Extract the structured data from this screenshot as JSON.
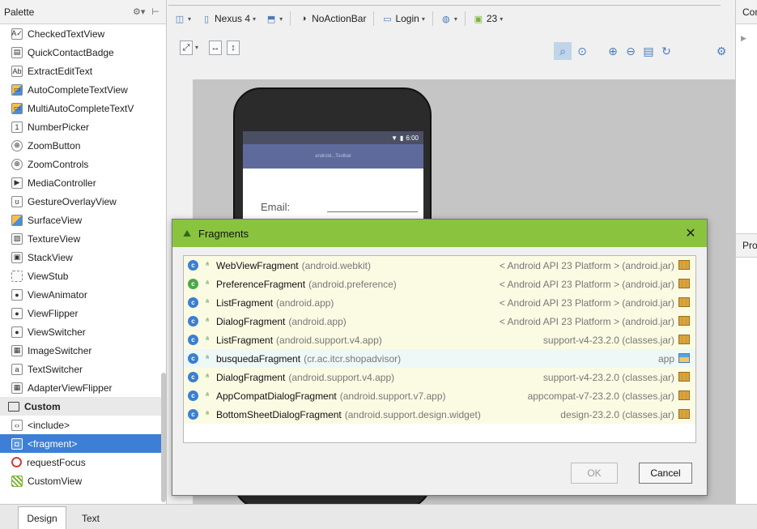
{
  "palette": {
    "title": "Palette",
    "items": [
      {
        "label": "CheckedTextView",
        "icon": "checked-text-icon",
        "glyph": "A✓"
      },
      {
        "label": "QuickContactBadge",
        "icon": "contact-badge-icon",
        "glyph": "▤"
      },
      {
        "label": "ExtractEditText",
        "icon": "edit-text-icon",
        "glyph": "Ab"
      },
      {
        "label": "AutoCompleteTextView",
        "icon": "autocomplete-icon",
        "glyph": "▭"
      },
      {
        "label": "MultiAutoCompleteTextV",
        "icon": "multi-autocomplete-icon",
        "glyph": "▭"
      },
      {
        "label": "NumberPicker",
        "icon": "number-picker-icon",
        "glyph": "1"
      },
      {
        "label": "ZoomButton",
        "icon": "zoom-button-icon",
        "glyph": "⊕"
      },
      {
        "label": "ZoomControls",
        "icon": "zoom-controls-icon",
        "glyph": "⊕"
      },
      {
        "label": "MediaController",
        "icon": "media-controller-icon",
        "glyph": "▶"
      },
      {
        "label": "GestureOverlayView",
        "icon": "gesture-overlay-icon",
        "glyph": "ʊ"
      },
      {
        "label": "SurfaceView",
        "icon": "surface-view-icon",
        "glyph": ""
      },
      {
        "label": "TextureView",
        "icon": "texture-view-icon",
        "glyph": "▨"
      },
      {
        "label": "StackView",
        "icon": "stack-view-icon",
        "glyph": "▣"
      },
      {
        "label": "ViewStub",
        "icon": "view-stub-icon",
        "glyph": ""
      },
      {
        "label": "ViewAnimator",
        "icon": "view-animator-icon",
        "glyph": "●"
      },
      {
        "label": "ViewFlipper",
        "icon": "view-flipper-icon",
        "glyph": "●"
      },
      {
        "label": "ViewSwitcher",
        "icon": "view-switcher-icon",
        "glyph": "●"
      },
      {
        "label": "ImageSwitcher",
        "icon": "image-switcher-icon",
        "glyph": "▦"
      },
      {
        "label": "TextSwitcher",
        "icon": "text-switcher-icon",
        "glyph": "a"
      },
      {
        "label": "AdapterViewFlipper",
        "icon": "adapter-flipper-icon",
        "glyph": "▦"
      }
    ],
    "category_custom": "Custom",
    "custom_items": [
      {
        "label": "<include>",
        "icon": "include-icon",
        "glyph": "‹›"
      },
      {
        "label": "<fragment>",
        "icon": "fragment-icon",
        "glyph": "◘"
      },
      {
        "label": "requestFocus",
        "icon": "request-focus-icon",
        "glyph": ""
      },
      {
        "label": "CustomView",
        "icon": "custom-view-icon",
        "glyph": ""
      }
    ]
  },
  "toolbar": {
    "device": "Nexus 4",
    "theme": "NoActionBar",
    "activity": "Login",
    "api": "23"
  },
  "phone": {
    "status_time": "6:00",
    "app_bar_text": "android...Toolbar",
    "email_label": "Email:"
  },
  "right_panel": {
    "component_tree_header": "Component Tree",
    "properties_header": "Properties"
  },
  "bottom_tabs": {
    "design": "Design",
    "text": "Text"
  },
  "dialog": {
    "title": "Fragments",
    "close_glyph": "✕",
    "ok_label": "OK",
    "cancel_label": "Cancel",
    "results": [
      {
        "name": "WebViewFragment",
        "pkg": "(android.webkit)",
        "source": "< Android API 23 Platform > (android.jar)",
        "kind": "platform",
        "icon_style": "blue"
      },
      {
        "name": "PreferenceFragment",
        "pkg": "(android.preference)",
        "source": "< Android API 23 Platform > (android.jar)",
        "kind": "platform",
        "icon_style": "green"
      },
      {
        "name": "ListFragment",
        "pkg": "(android.app)",
        "source": "< Android API 23 Platform > (android.jar)",
        "kind": "platform",
        "icon_style": "blue"
      },
      {
        "name": "DialogFragment",
        "pkg": "(android.app)",
        "source": "< Android API 23 Platform > (android.jar)",
        "kind": "platform",
        "icon_style": "blue"
      },
      {
        "name": "ListFragment",
        "pkg": "(android.support.v4.app)",
        "source": "support-v4-23.2.0 (classes.jar)",
        "kind": "library",
        "icon_style": "blue"
      },
      {
        "name": "busquedaFragment",
        "pkg": "(cr.ac.itcr.shopadvisor)",
        "source": "app",
        "kind": "module",
        "icon_style": "blue"
      },
      {
        "name": "DialogFragment",
        "pkg": "(android.support.v4.app)",
        "source": "support-v4-23.2.0 (classes.jar)",
        "kind": "library",
        "icon_style": "blue"
      },
      {
        "name": "AppCompatDialogFragment",
        "pkg": "(android.support.v7.app)",
        "source": "appcompat-v7-23.2.0 (classes.jar)",
        "kind": "library",
        "icon_style": "blue"
      },
      {
        "name": "BottomSheetDialogFragment",
        "pkg": "(android.support.design.widget)",
        "source": "design-23.2.0 (classes.jar)",
        "kind": "library",
        "icon_style": "blue"
      }
    ]
  },
  "colors": {
    "dialog_title_bar": "#8ac43f",
    "selection": "#3d7fd6",
    "platform_row": "#fbfbe4",
    "module_row": "#eef8f6"
  }
}
